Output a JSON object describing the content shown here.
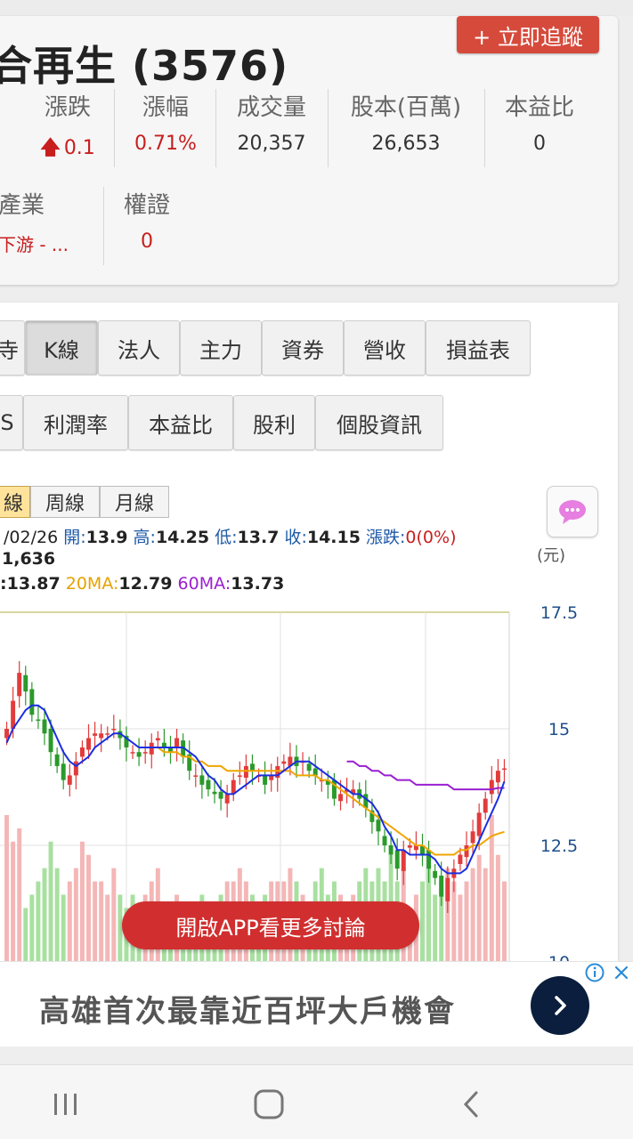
{
  "stock": {
    "title": "合再生 (3576)",
    "track_button": "+ 立即追蹤"
  },
  "stats_row1": [
    {
      "label": "漲跌",
      "value": "0.1",
      "arrow": "up"
    },
    {
      "label": "漲幅",
      "value": "0.71%"
    },
    {
      "label": "成交量",
      "value": "20,357"
    },
    {
      "label": "股本(百萬)",
      "value": "26,653"
    },
    {
      "label": "本益比",
      "value": "0"
    }
  ],
  "stats_row2": [
    {
      "label": "產業",
      "value": "下游 - ..."
    },
    {
      "label": "權證",
      "value": "0"
    }
  ],
  "tabs_row1": [
    "寺",
    "K線",
    "法人",
    "主力",
    "資券",
    "營收",
    "損益表"
  ],
  "tabs_row2": [
    "S",
    "利潤率",
    "本益比",
    "股利",
    "個股資訊"
  ],
  "period_tabs": [
    "線",
    "周線",
    "月線"
  ],
  "ohlc": {
    "date": "/02/26",
    "open_label": "開:",
    "open": "13.9",
    "high_label": "高:",
    "high": "14.25",
    "low_label": "低:",
    "low": "13.7",
    "close_label": "收:",
    "close": "14.15",
    "change_label": "漲跌:",
    "change": "0(0%)"
  },
  "volume_line": "1,636",
  "ma": {
    "ma5_value": ":13.87",
    "ma20_label": "20MA:",
    "ma20_value": "12.79",
    "ma60_label": "60MA:",
    "ma60_value": "13.73"
  },
  "unit_label": "(元)",
  "open_app_button": "開啟APP看更多討論",
  "ad": {
    "text": "高雄首次最靠近百坪大戶機會"
  },
  "colors": {
    "up": "#c81e1e",
    "candle_up": "#e23b3b",
    "candle_down": "#2a9a2a",
    "ma5": "#1a2ee0",
    "ma20": "#f0a500",
    "ma60": "#9a1fd0",
    "volume_up": "#f4b6b6",
    "volume_down": "#a8e0a0",
    "axis": "#1f4f8a"
  },
  "chart_data": {
    "type": "candlestick",
    "y_ticks": [
      17.5,
      15,
      12.5,
      10
    ],
    "ylim": [
      10,
      17.8
    ],
    "last_candle": {
      "open": 13.9,
      "high": 14.25,
      "low": 13.7,
      "close": 14.15
    },
    "ma_last": {
      "ma5": 13.87,
      "ma20": 12.79,
      "ma60": 13.73
    },
    "last_volume": 1636,
    "close_series": [
      15.0,
      15.6,
      16.2,
      15.8,
      15.3,
      15.2,
      14.9,
      14.5,
      14.2,
      13.9,
      14.0,
      14.3,
      14.6,
      14.8,
      14.9,
      14.9,
      14.9,
      15.0,
      14.8,
      14.6,
      14.5,
      14.4,
      14.5,
      14.7,
      14.8,
      14.6,
      14.5,
      14.8,
      14.4,
      14.1,
      14.0,
      13.8,
      13.7,
      13.6,
      13.5,
      13.6,
      13.9,
      14.0,
      14.2,
      14.1,
      14.0,
      13.8,
      14.0,
      14.2,
      14.3,
      14.4,
      14.2,
      14.3,
      14.1,
      14.0,
      13.9,
      13.8,
      13.5,
      13.6,
      13.7,
      13.7,
      13.5,
      13.3,
      13.0,
      12.8,
      12.5,
      12.3,
      12.0,
      12.4,
      12.5,
      12.5,
      12.3,
      12.0,
      11.8,
      11.4,
      11.8,
      12.0,
      12.3,
      12.5,
      12.8,
      13.2,
      13.5,
      13.9,
      14.1,
      14.15
    ],
    "ma5_series": [
      14.7,
      15.0,
      15.2,
      15.4,
      15.5,
      15.5,
      15.4,
      15.1,
      14.8,
      14.5,
      14.3,
      14.2,
      14.3,
      14.4,
      14.6,
      14.7,
      14.8,
      14.9,
      14.9,
      14.8,
      14.7,
      14.6,
      14.6,
      14.6,
      14.6,
      14.6,
      14.6,
      14.6,
      14.6,
      14.5,
      14.4,
      14.2,
      14.0,
      13.9,
      13.7,
      13.6,
      13.6,
      13.7,
      13.8,
      13.9,
      14.0,
      14.0,
      14.0,
      14.0,
      14.1,
      14.2,
      14.3,
      14.3,
      14.3,
      14.2,
      14.1,
      14.0,
      13.9,
      13.8,
      13.7,
      13.6,
      13.6,
      13.5,
      13.4,
      13.2,
      12.9,
      12.7,
      12.4,
      12.4,
      12.3,
      12.3,
      12.3,
      12.3,
      12.2,
      12.0,
      11.9,
      11.9,
      11.9,
      12.0,
      12.3,
      12.6,
      12.9,
      13.2,
      13.5,
      13.87
    ],
    "ma20_series": [
      null,
      null,
      null,
      null,
      null,
      null,
      null,
      null,
      null,
      null,
      null,
      null,
      null,
      null,
      null,
      null,
      null,
      null,
      null,
      null,
      null,
      null,
      null,
      14.6,
      14.6,
      14.5,
      14.5,
      14.5,
      14.4,
      14.4,
      14.3,
      14.3,
      14.2,
      14.2,
      14.2,
      14.1,
      14.1,
      14.1,
      14.1,
      14.1,
      14.1,
      14.1,
      14.1,
      14.1,
      14.1,
      14.1,
      14.0,
      14.0,
      14.0,
      14.0,
      13.9,
      13.9,
      13.8,
      13.7,
      13.6,
      13.5,
      13.4,
      13.3,
      13.2,
      13.1,
      13.0,
      12.9,
      12.8,
      12.7,
      12.6,
      12.5,
      12.5,
      12.4,
      12.3,
      12.3,
      12.3,
      12.3,
      12.4,
      12.4,
      12.5,
      12.5,
      12.6,
      12.7,
      12.75,
      12.79
    ],
    "ma60_series": [
      null,
      null,
      null,
      null,
      null,
      null,
      null,
      null,
      null,
      null,
      null,
      null,
      null,
      null,
      null,
      null,
      null,
      null,
      null,
      null,
      null,
      null,
      null,
      null,
      null,
      null,
      null,
      null,
      null,
      null,
      null,
      null,
      null,
      null,
      null,
      null,
      null,
      null,
      null,
      null,
      null,
      null,
      null,
      null,
      null,
      null,
      null,
      null,
      null,
      null,
      null,
      null,
      null,
      null,
      14.3,
      14.3,
      14.2,
      14.2,
      14.1,
      14.1,
      14.0,
      14.0,
      13.9,
      13.9,
      13.9,
      13.8,
      13.8,
      13.8,
      13.8,
      13.8,
      13.8,
      13.7,
      13.7,
      13.7,
      13.7,
      13.7,
      13.7,
      13.7,
      13.73,
      13.73
    ],
    "volume_series": [
      0.55,
      0.45,
      0.5,
      0.2,
      0.25,
      0.3,
      0.35,
      0.45,
      0.35,
      0.25,
      0.3,
      0.35,
      0.45,
      0.4,
      0.3,
      0.3,
      0.25,
      0.35,
      0.25,
      0.2,
      0.25,
      0.2,
      0.25,
      0.3,
      0.35,
      0.2,
      0.2,
      0.25,
      0.2,
      0.18,
      0.22,
      0.25,
      0.2,
      0.2,
      0.25,
      0.3,
      0.3,
      0.35,
      0.3,
      0.25,
      0.2,
      0.25,
      0.3,
      0.3,
      0.3,
      0.35,
      0.3,
      0.25,
      0.2,
      0.3,
      0.35,
      0.25,
      0.3,
      0.25,
      0.2,
      0.25,
      0.3,
      0.35,
      0.3,
      0.35,
      0.3,
      0.4,
      0.3,
      0.35,
      0.2,
      0.25,
      0.3,
      0.35,
      0.25,
      0.3,
      0.35,
      0.3,
      0.25,
      0.3,
      0.35,
      0.4,
      0.35,
      0.55,
      0.4,
      0.3
    ]
  }
}
